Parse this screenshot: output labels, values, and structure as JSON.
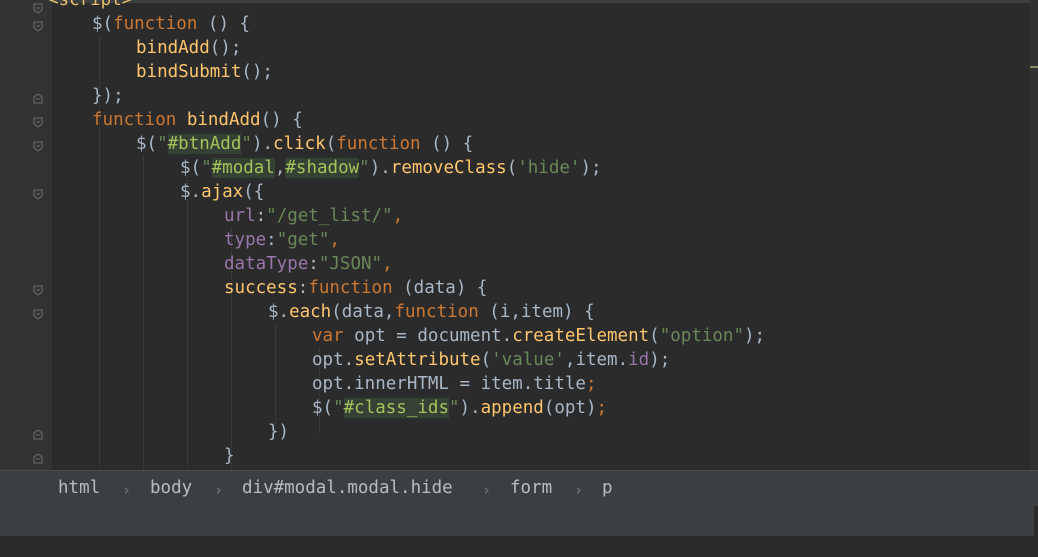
{
  "editor": {
    "lines": [
      [
        {
          "t": "<script>",
          "c": "tag"
        }
      ],
      [
        {
          "t": "$(",
          "c": "plain"
        },
        {
          "t": "function",
          "c": "kw"
        },
        {
          "t": " () {",
          "c": "plain"
        }
      ],
      [
        {
          "t": "bindAdd",
          "c": "fn"
        },
        {
          "t": "();",
          "c": "plain"
        }
      ],
      [
        {
          "t": "bindSubmit",
          "c": "fn"
        },
        {
          "t": "();",
          "c": "plain"
        }
      ],
      [
        {
          "t": "});",
          "c": "plain"
        }
      ],
      [
        {
          "t": "function ",
          "c": "kw"
        },
        {
          "t": "bindAdd",
          "c": "fn"
        },
        {
          "t": "() {",
          "c": "plain"
        }
      ],
      [
        {
          "t": "$(",
          "c": "plain"
        },
        {
          "t": "\"",
          "c": "str"
        },
        {
          "t": "#btnAdd",
          "c": "sel"
        },
        {
          "t": "\"",
          "c": "str"
        },
        {
          "t": ").",
          "c": "plain"
        },
        {
          "t": "click",
          "c": "fn"
        },
        {
          "t": "(",
          "c": "plain"
        },
        {
          "t": "function",
          "c": "kw"
        },
        {
          "t": " () {",
          "c": "plain"
        }
      ],
      [
        {
          "t": "$(",
          "c": "plain"
        },
        {
          "t": "\"",
          "c": "str"
        },
        {
          "t": "#modal",
          "c": "sel"
        },
        {
          "t": ",",
          "c": "plain"
        },
        {
          "t": "#shadow",
          "c": "sel"
        },
        {
          "t": "\"",
          "c": "str"
        },
        {
          "t": ").",
          "c": "plain"
        },
        {
          "t": "removeClass",
          "c": "fn"
        },
        {
          "t": "(",
          "c": "plain"
        },
        {
          "t": "'hide'",
          "c": "str"
        },
        {
          "t": ");",
          "c": "plain"
        }
      ],
      [
        {
          "t": "$.",
          "c": "plain"
        },
        {
          "t": "ajax",
          "c": "fn"
        },
        {
          "t": "({",
          "c": "plain"
        }
      ],
      [
        {
          "t": "url",
          "c": "prop"
        },
        {
          "t": ":",
          "c": "plain"
        },
        {
          "t": "\"/get_list/\"",
          "c": "str"
        },
        {
          "t": ",",
          "c": "kw"
        }
      ],
      [
        {
          "t": "type",
          "c": "prop"
        },
        {
          "t": ":",
          "c": "plain"
        },
        {
          "t": "\"get\"",
          "c": "str"
        },
        {
          "t": ",",
          "c": "kw"
        }
      ],
      [
        {
          "t": "dataType",
          "c": "prop"
        },
        {
          "t": ":",
          "c": "plain"
        },
        {
          "t": "\"JSON\"",
          "c": "str"
        },
        {
          "t": ",",
          "c": "kw"
        }
      ],
      [
        {
          "t": "success",
          "c": "fn"
        },
        {
          "t": ":",
          "c": "plain"
        },
        {
          "t": "function",
          "c": "kw"
        },
        {
          "t": " (data) {",
          "c": "plain"
        }
      ],
      [
        {
          "t": "$.",
          "c": "plain"
        },
        {
          "t": "each",
          "c": "fn"
        },
        {
          "t": "(data,",
          "c": "plain"
        },
        {
          "t": "function",
          "c": "kw"
        },
        {
          "t": " (i,item) {",
          "c": "plain"
        }
      ],
      [
        {
          "t": "var ",
          "c": "kw"
        },
        {
          "t": "opt = document.",
          "c": "plain"
        },
        {
          "t": "createElement",
          "c": "fn"
        },
        {
          "t": "(",
          "c": "plain"
        },
        {
          "t": "\"option\"",
          "c": "str"
        },
        {
          "t": ");",
          "c": "plain"
        }
      ],
      [
        {
          "t": "opt.",
          "c": "plain"
        },
        {
          "t": "setAttribute",
          "c": "fn"
        },
        {
          "t": "(",
          "c": "plain"
        },
        {
          "t": "'value'",
          "c": "str"
        },
        {
          "t": ",item.",
          "c": "plain"
        },
        {
          "t": "id",
          "c": "prop"
        },
        {
          "t": ");",
          "c": "plain"
        }
      ],
      [
        {
          "t": "opt.innerHTML = item.title",
          "c": "plain"
        },
        {
          "t": ";",
          "c": "kw"
        }
      ],
      [
        {
          "t": "$(",
          "c": "plain"
        },
        {
          "t": "\"",
          "c": "str"
        },
        {
          "t": "#class_ids",
          "c": "sel"
        },
        {
          "t": "\"",
          "c": "str"
        },
        {
          "t": ").",
          "c": "plain"
        },
        {
          "t": "append",
          "c": "fn"
        },
        {
          "t": "(opt)",
          "c": "plain"
        },
        {
          "t": ";",
          "c": "kw"
        }
      ],
      [
        {
          "t": "})",
          "c": "plain"
        }
      ],
      [
        {
          "t": "}",
          "c": "plain"
        }
      ]
    ]
  },
  "breadcrumb": {
    "items": [
      "html",
      "body",
      "div#modal.modal.hide",
      "form",
      "p"
    ],
    "separator": "›"
  }
}
